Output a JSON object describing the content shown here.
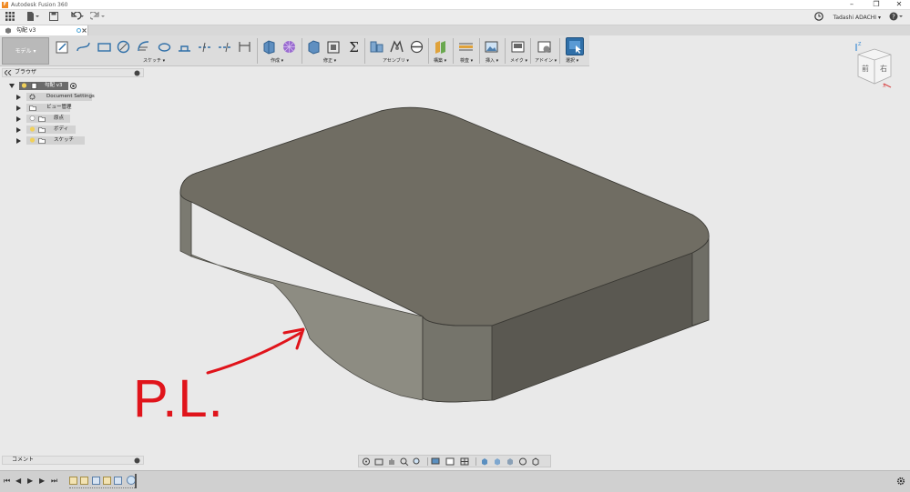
{
  "window": {
    "title": "Autodesk Fusion 360",
    "app_logo": "F",
    "minimize": "–",
    "maximize": "❐",
    "close": "✕"
  },
  "quick_access": {
    "grid_icon": "grid-icon",
    "file_icon": "file-icon",
    "save_icon": "save-icon",
    "undo_icon": "undo-icon",
    "redo_icon": "redo-icon",
    "user_name": "Tadashi ADACHI ▾",
    "clock_icon": "clock-icon",
    "help_icon": "help-icon"
  },
  "tab": {
    "label": "勾配 v3"
  },
  "toolbar": {
    "mode_label": "モデル ▾",
    "groups": [
      "スケッチ ▾",
      "作成 ▾",
      "修正 ▾",
      "アセンブリ ▾",
      "構築 ▾",
      "検査 ▾",
      "挿入 ▾",
      "メイク ▾",
      "アドイン ▾",
      "選択 ▾"
    ]
  },
  "browser": {
    "title": "ブラウザ",
    "root": "勾配 v3",
    "items": [
      "Document Settings",
      "ビュー管理",
      "原点",
      "ボディ",
      "スケッチ"
    ]
  },
  "viewcube": {
    "front": "前",
    "right": "右",
    "axis_z": "Z",
    "axis_x": "X"
  },
  "annotation": {
    "text": "P.L.",
    "color": "#e0141b"
  },
  "comments": {
    "label": "コメント"
  },
  "colors": {
    "body_top": "#6f6c62",
    "body_side_left": "#8c8b81",
    "body_side_front": "#5a5851",
    "toolbar_bg": "#dcdcdc",
    "select_accent": "#2f6fa8"
  }
}
